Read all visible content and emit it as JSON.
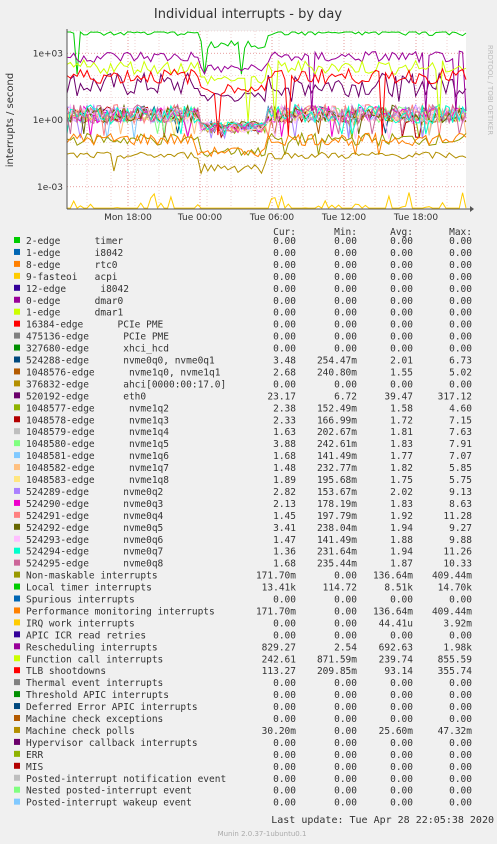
{
  "chart_data": {
    "type": "line",
    "title": "Individual interrupts - by day",
    "ylabel": "interrupts / second",
    "side_label": "RRDTOOL / TOBI OETIKER",
    "y_scale": "log",
    "ylim": [
      0.0001,
      10000
    ],
    "y_ticks": [
      {
        "value": 1000,
        "label": "1e+03"
      },
      {
        "value": 1,
        "label": "1e+00"
      },
      {
        "value": 0.001,
        "label": "1e-03"
      }
    ],
    "x_ticks": [
      "Mon 18:00",
      "Tue 00:00",
      "Tue 06:00",
      "Tue 12:00",
      "Tue 18:00"
    ],
    "grid": true,
    "column_headers": [
      "Cur:",
      "Min:",
      "Avg:",
      "Max:"
    ],
    "series": [
      {
        "name": "2-edge      timer",
        "color": "#00cc00",
        "cur": "0.00",
        "min": "0.00",
        "avg": "0.00",
        "max": "0.00"
      },
      {
        "name": "1-edge      i8042",
        "color": "#0066b3",
        "cur": "0.00",
        "min": "0.00",
        "avg": "0.00",
        "max": "0.00"
      },
      {
        "name": "8-edge      rtc0",
        "color": "#ff8000",
        "cur": "0.00",
        "min": "0.00",
        "avg": "0.00",
        "max": "0.00"
      },
      {
        "name": "9-fasteoi   acpi",
        "color": "#ffcc00",
        "cur": "0.00",
        "min": "0.00",
        "avg": "0.00",
        "max": "0.00"
      },
      {
        "name": "12-edge      i8042",
        "color": "#330099",
        "cur": "0.00",
        "min": "0.00",
        "avg": "0.00",
        "max": "0.00"
      },
      {
        "name": "0-edge      dmar0",
        "color": "#990099",
        "cur": "0.00",
        "min": "0.00",
        "avg": "0.00",
        "max": "0.00"
      },
      {
        "name": "1-edge      dmar1",
        "color": "#ccff00",
        "cur": "0.00",
        "min": "0.00",
        "avg": "0.00",
        "max": "0.00"
      },
      {
        "name": "16384-edge      PCIe PME",
        "color": "#ff0000",
        "cur": "0.00",
        "min": "0.00",
        "avg": "0.00",
        "max": "0.00"
      },
      {
        "name": "475136-edge      PCIe PME",
        "color": "#808080",
        "cur": "0.00",
        "min": "0.00",
        "avg": "0.00",
        "max": "0.00"
      },
      {
        "name": "327680-edge      xhci_hcd",
        "color": "#008f00",
        "cur": "0.00",
        "min": "0.00",
        "avg": "0.00",
        "max": "0.00"
      },
      {
        "name": "524288-edge      nvme0q0, nvme0q1",
        "color": "#00487d",
        "cur": "3.48",
        "min": "254.47m",
        "avg": "2.01",
        "max": "6.73"
      },
      {
        "name": "1048576-edge      nvme1q0, nvme1q1",
        "color": "#b35a00",
        "cur": "2.68",
        "min": "240.80m",
        "avg": "1.55",
        "max": "5.02"
      },
      {
        "name": "376832-edge      ahci[0000:00:17.0]",
        "color": "#b38f00",
        "cur": "0.00",
        "min": "0.00",
        "avg": "0.00",
        "max": "0.00"
      },
      {
        "name": "520192-edge      eth0",
        "color": "#6b006b",
        "cur": "23.17",
        "min": "6.72",
        "avg": "39.47",
        "max": "317.12"
      },
      {
        "name": "1048577-edge      nvme1q2",
        "color": "#8fb300",
        "cur": "2.38",
        "min": "152.49m",
        "avg": "1.58",
        "max": "4.60"
      },
      {
        "name": "1048578-edge      nvme1q3",
        "color": "#b30000",
        "cur": "2.33",
        "min": "166.99m",
        "avg": "1.72",
        "max": "7.15"
      },
      {
        "name": "1048579-edge      nvme1q4",
        "color": "#bebebe",
        "cur": "1.63",
        "min": "202.67m",
        "avg": "1.81",
        "max": "7.63"
      },
      {
        "name": "1048580-edge      nvme1q5",
        "color": "#80ff80",
        "cur": "3.88",
        "min": "242.61m",
        "avg": "1.83",
        "max": "7.91"
      },
      {
        "name": "1048581-edge      nvme1q6",
        "color": "#80c9ff",
        "cur": "1.68",
        "min": "141.49m",
        "avg": "1.77",
        "max": "7.07"
      },
      {
        "name": "1048582-edge      nvme1q7",
        "color": "#ffc080",
        "cur": "1.48",
        "min": "232.77m",
        "avg": "1.82",
        "max": "5.85"
      },
      {
        "name": "1048583-edge      nvme1q8",
        "color": "#ffe680",
        "cur": "1.89",
        "min": "195.68m",
        "avg": "1.75",
        "max": "5.75"
      },
      {
        "name": "524289-edge      nvme0q2",
        "color": "#aa80ff",
        "cur": "2.82",
        "min": "153.67m",
        "avg": "2.02",
        "max": "9.13"
      },
      {
        "name": "524290-edge      nvme0q3",
        "color": "#ee00cc",
        "cur": "2.13",
        "min": "178.19m",
        "avg": "1.83",
        "max": "8.63"
      },
      {
        "name": "524291-edge      nvme0q4",
        "color": "#ff8080",
        "cur": "1.45",
        "min": "197.79m",
        "avg": "1.92",
        "max": "11.28"
      },
      {
        "name": "524292-edge      nvme0q5",
        "color": "#666600",
        "cur": "3.41",
        "min": "238.04m",
        "avg": "1.94",
        "max": "9.27"
      },
      {
        "name": "524293-edge      nvme0q6",
        "color": "#ffbfff",
        "cur": "1.47",
        "min": "141.49m",
        "avg": "1.88",
        "max": "9.88"
      },
      {
        "name": "524294-edge      nvme0q7",
        "color": "#00ffcc",
        "cur": "1.36",
        "min": "231.64m",
        "avg": "1.94",
        "max": "11.26"
      },
      {
        "name": "524295-edge      nvme0q8",
        "color": "#cc6699",
        "cur": "1.68",
        "min": "235.44m",
        "avg": "1.87",
        "max": "10.33"
      },
      {
        "name": "Non-maskable interrupts",
        "color": "#999900",
        "cur": "171.70m",
        "min": "0.00",
        "avg": "136.64m",
        "max": "409.44m"
      },
      {
        "name": "Local timer interrupts",
        "color": "#00cc00",
        "cur": "13.41k",
        "min": "114.72",
        "avg": "8.51k",
        "max": "14.70k"
      },
      {
        "name": "Spurious interrupts",
        "color": "#0066b3",
        "cur": "0.00",
        "min": "0.00",
        "avg": "0.00",
        "max": "0.00"
      },
      {
        "name": "Performance monitoring interrupts",
        "color": "#ff8000",
        "cur": "171.70m",
        "min": "0.00",
        "avg": "136.64m",
        "max": "409.44m"
      },
      {
        "name": "IRQ work interrupts",
        "color": "#ffcc00",
        "cur": "0.00",
        "min": "0.00",
        "avg": "44.41u",
        "max": "3.92m"
      },
      {
        "name": "APIC ICR read retries",
        "color": "#330099",
        "cur": "0.00",
        "min": "0.00",
        "avg": "0.00",
        "max": "0.00"
      },
      {
        "name": "Rescheduling interrupts",
        "color": "#990099",
        "cur": "829.27",
        "min": "2.54",
        "avg": "692.63",
        "max": "1.98k"
      },
      {
        "name": "Function call interrupts",
        "color": "#ccff00",
        "cur": "242.61",
        "min": "871.59m",
        "avg": "239.74",
        "max": "855.59"
      },
      {
        "name": "TLB shootdowns",
        "color": "#ff0000",
        "cur": "113.27",
        "min": "209.85m",
        "avg": "93.14",
        "max": "355.74"
      },
      {
        "name": "Thermal event interrupts",
        "color": "#808080",
        "cur": "0.00",
        "min": "0.00",
        "avg": "0.00",
        "max": "0.00"
      },
      {
        "name": "Threshold APIC interrupts",
        "color": "#008f00",
        "cur": "0.00",
        "min": "0.00",
        "avg": "0.00",
        "max": "0.00"
      },
      {
        "name": "Deferred Error APIC interrupts",
        "color": "#00487d",
        "cur": "0.00",
        "min": "0.00",
        "avg": "0.00",
        "max": "0.00"
      },
      {
        "name": "Machine check exceptions",
        "color": "#b35a00",
        "cur": "0.00",
        "min": "0.00",
        "avg": "0.00",
        "max": "0.00"
      },
      {
        "name": "Machine check polls",
        "color": "#b38f00",
        "cur": "30.20m",
        "min": "0.00",
        "avg": "25.60m",
        "max": "47.32m"
      },
      {
        "name": "Hypervisor callback interrupts",
        "color": "#6b006b",
        "cur": "0.00",
        "min": "0.00",
        "avg": "0.00",
        "max": "0.00"
      },
      {
        "name": "ERR",
        "color": "#8fb300",
        "cur": "0.00",
        "min": "0.00",
        "avg": "0.00",
        "max": "0.00"
      },
      {
        "name": "MIS",
        "color": "#b30000",
        "cur": "0.00",
        "min": "0.00",
        "avg": "0.00",
        "max": "0.00"
      },
      {
        "name": "Posted-interrupt notification event",
        "color": "#bebebe",
        "cur": "0.00",
        "min": "0.00",
        "avg": "0.00",
        "max": "0.00"
      },
      {
        "name": "Nested posted-interrupt event",
        "color": "#80ff80",
        "cur": "0.00",
        "min": "0.00",
        "avg": "0.00",
        "max": "0.00"
      },
      {
        "name": "Posted-interrupt wakeup event",
        "color": "#80c9ff",
        "cur": "0.00",
        "min": "0.00",
        "avg": "0.00",
        "max": "0.00"
      }
    ]
  },
  "footer": {
    "last_update": "Last update: Tue Apr 28 22:05:38 2020",
    "munin_version": "Munin 2.0.37-1ubuntu0.1"
  }
}
